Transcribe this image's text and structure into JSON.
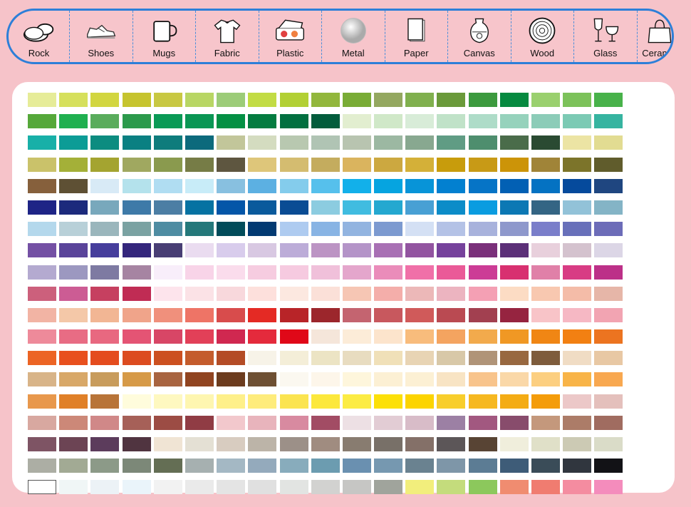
{
  "materials": [
    {
      "label": "Rock",
      "icon": "rock-icon"
    },
    {
      "label": "Shoes",
      "icon": "shoe-icon"
    },
    {
      "label": "Mugs",
      "icon": "mug-icon"
    },
    {
      "label": "Fabric",
      "icon": "tshirt-icon"
    },
    {
      "label": "Plastic",
      "icon": "plastic-container-icon"
    },
    {
      "label": "Metal",
      "icon": "metal-disc-icon"
    },
    {
      "label": "Paper",
      "icon": "paper-stack-icon"
    },
    {
      "label": "Canvas",
      "icon": "vase-icon"
    },
    {
      "label": "Wood",
      "icon": "wood-log-icon"
    },
    {
      "label": "Glass",
      "icon": "wine-glass-icon"
    },
    {
      "label": "Ceramic",
      "icon": "ceramic-bag-icon"
    }
  ],
  "colors": {
    "background": "#f6c3c9",
    "toolbar_border": "#2d7fd8",
    "panel": "#ffffff"
  },
  "swatch_rows": [
    [
      "#e6ec98",
      "#d6e05c",
      "#d2d640",
      "#c6c42e",
      "#c8c842",
      "#b8d664",
      "#9ccc78",
      "#c2dc44",
      "#b2d034",
      "#92b73c",
      "#79ac36",
      "#94a860",
      "#80b04e",
      "#6a9a3a",
      "#3c9a3e",
      "#068a40",
      "#9ad06e",
      "#7cc25a",
      "#48b24a"
    ],
    [
      "#56a83a",
      "#20b050",
      "#5aac5c",
      "#2c9a4c",
      "#0a9a56",
      "#0a9654",
      "#049044",
      "#047c40",
      "#027040",
      "#025c3c",
      "#e2eed0",
      "#d0e8c8",
      "#d8ecd8",
      "#c0e2c8",
      "#aedcc8",
      "#96d2bc",
      "#8cccb8",
      "#7ccab4",
      "#36b4a0"
    ],
    [
      "#18b0a8",
      "#0c9c96",
      "#0c8c80",
      "#0a8082",
      "#0e7c7c",
      "#0c6a7c",
      "#c2c69a",
      "#d4dcc0",
      "#b8c8b0",
      "#b0c4b4",
      "#b8c4b0",
      "#9cb8a2",
      "#88a890",
      "#609c84",
      "#4e8e6e",
      "#4a6c4a",
      "#2a4a32",
      "#ece4a4",
      "#e2dc92"
    ],
    [
      "#cac26a",
      "#a4b038",
      "#a4a430",
      "#a0a860",
      "#8a9a4e",
      "#767c46",
      "#5e5640",
      "#dec67a",
      "#d4bc70",
      "#c4ac5e",
      "#dab45e",
      "#cca840",
      "#d4b038",
      "#c89c0c",
      "#c89a16",
      "#cc9408",
      "#a08438",
      "#7c742a",
      "#605c2c"
    ],
    [
      "#86603c",
      "#5e5034",
      "#d8eaf6",
      "#b4e2ec",
      "#b0ddf2",
      "#c8ecf8",
      "#88c0e0",
      "#5cb0e2",
      "#84ccec",
      "#56c0ec",
      "#12b0ea",
      "#06a4e0",
      "#0894d8",
      "#0280d0",
      "#0674c6",
      "#0260b4",
      "#0472c2",
      "#054a9c",
      "#1f4680"
    ],
    [
      "#1e2486",
      "#1c2a7c",
      "#78a8bc",
      "#3e7aa8",
      "#4c7ea4",
      "#0672a2",
      "#0456a8",
      "#0a5a9c",
      "#0a4c94",
      "#8ccce0",
      "#40bce0",
      "#24a8d0",
      "#48a0d4",
      "#0c8cc8",
      "#0a9ce0",
      "#0c78b4",
      "#346584",
      "#92c2d8",
      "#84b4c6"
    ],
    [
      "#b4d8ec",
      "#b8d0d8",
      "#9ab6bc",
      "#7aa2a2",
      "#4e8ca2",
      "#24787a",
      "#024c5a",
      "#023a72",
      "#aecbf0",
      "#88b4e4",
      "#92b4e0",
      "#7c9ad0",
      "#d4e0f4",
      "#b4c2e6",
      "#a8b2dc",
      "#8e98cc",
      "#7a7eca",
      "#6870ba",
      "#6c6cb8"
    ],
    [
      "#7450a4",
      "#5a449a",
      "#463e9c",
      "#34267c",
      "#483e74",
      "#eadcf0",
      "#d8ccec",
      "#d8c8e2",
      "#bcacd8",
      "#bc94c4",
      "#b494c8",
      "#a870b4",
      "#9254a0",
      "#76429c",
      "#7a307a",
      "#5c3078",
      "#e8d0dc",
      "#d4c2ce",
      "#dcd6e6"
    ],
    [
      "#b4aad0",
      "#9c98c0",
      "#7e7aa2",
      "#a684a2",
      "#f8eefa",
      "#f8d4e8",
      "#fadcec",
      "#f6cce0",
      "#f6cae0",
      "#f0c0da",
      "#e4a6cc",
      "#ea8cba",
      "#f070a8",
      "#ea5a98",
      "#cc3c96",
      "#d83070",
      "#e080a8",
      "#d83c84",
      "#bc3088"
    ],
    [
      "#cc607c",
      "#cc5c94",
      "#c64060",
      "#c02c54",
      "#fde4ec",
      "#fbe2e6",
      "#f8d8dc",
      "#fde0dc",
      "#fce8e0",
      "#fbe0d8",
      "#f6c6b4",
      "#f4aeaa",
      "#ecb8b8",
      "#ecb4c0",
      "#f4a0b4",
      "#fcdcc4",
      "#f8c8b0",
      "#f4bca8",
      "#e6b6a8"
    ],
    [
      "#f2b4a4",
      "#f4c8a8",
      "#f2b694",
      "#f0a48a",
      "#f0907c",
      "#ee7466",
      "#d84c4c",
      "#e42a24",
      "#b82428",
      "#9c262c",
      "#c46470",
      "#c8585e",
      "#d05a5a",
      "#ba4a52",
      "#a24050",
      "#962440",
      "#f8c4c8",
      "#f6b8c4",
      "#f2a4b2"
    ],
    [
      "#ee8a9a",
      "#e86c84",
      "#e86880",
      "#e45474",
      "#d84666",
      "#e24058",
      "#d02850",
      "#e42a3c",
      "#e00818",
      "#f5e6da",
      "#fcecd8",
      "#fce4cc",
      "#f8bc7c",
      "#f4a460",
      "#f2aa4c",
      "#f09824",
      "#f08614",
      "#f28012",
      "#ec7420"
    ],
    [
      "#ec6424",
      "#e8501e",
      "#e44c1e",
      "#dc4c20",
      "#cc5020",
      "#c45c2c",
      "#b44c26",
      "#f7f3e8",
      "#f4eed8",
      "#ece4c4",
      "#e8dcc0",
      "#f0e0b8",
      "#e8d4b4",
      "#d8c8a8",
      "#b09478",
      "#986840",
      "#7e5c3c",
      "#f0dcc4",
      "#e8c8a4"
    ],
    [
      "#d8b488",
      "#d8a868",
      "#c89c5c",
      "#d69a48",
      "#a86440",
      "#904420",
      "#6c3c1e",
      "#6e5034",
      "#fbf8f0",
      "#fdf6ea",
      "#fef6dc",
      "#fcf0d4",
      "#fcf0d4",
      "#f8e4c4",
      "#f8c48c",
      "#fad8a8",
      "#fccf80",
      "#f8b448",
      "#f8a850"
    ],
    [
      "#e8984c",
      "#e08028",
      "#b87438",
      "#fffcdc",
      "#fef8c0",
      "#fef6b0",
      "#fef08a",
      "#feec7c",
      "#fbe450",
      "#fce83c",
      "#fcec44",
      "#fce008",
      "#fcd400",
      "#f8ce2c",
      "#f6b820",
      "#f4ac14",
      "#f49c0a",
      "#ecc8c8",
      "#e4c0bc"
    ],
    [
      "#d8a8a0",
      "#cc8878",
      "#d08888",
      "#a66058",
      "#9c4c44",
      "#903c44",
      "#f2c8cc",
      "#e8b4bc",
      "#d88aa0",
      "#a24c64",
      "#ede0e4",
      "#e2ccd4",
      "#d8bcc8",
      "#9c80a4",
      "#a25880",
      "#884c6c",
      "#c4987c",
      "#ac7c68",
      "#a06c60"
    ],
    [
      "#7e5464",
      "#6c4454",
      "#5c3c5c",
      "#503440",
      "#f0e4d4",
      "#e4e0d4",
      "#d8ccc0",
      "#bcb4a8",
      "#9c9088",
      "#a08c80",
      "#887c70",
      "#787068",
      "#847068",
      "#5c5658",
      "#584434",
      "#f0eedc",
      "#e0e0c8",
      "#cccab4",
      "#dadcc8"
    ],
    [
      "#acaea4",
      "#a2aa94",
      "#8c9a88",
      "#7c8878",
      "#646e54",
      "#a6b0b0",
      "#a4b8c4",
      "#94aabc",
      "#88acbc",
      "#6c9cb0",
      "#6a90b0",
      "#7698b0",
      "#6a8290",
      "#7e96a8",
      "#5c7c94",
      "#3e5c78",
      "#3a4c58",
      "#30363e",
      "#121216"
    ],
    [
      "#ffffff",
      "#f0f6f6",
      "#ecf2f6",
      "#eaf4fa",
      "#f2f2f2",
      "#eaeaea",
      "#e4e4e4",
      "#e0e0e0",
      "#e2e4e2",
      "#d2d2d0",
      "#c6c6c4",
      "#a0a49c",
      "#f2ee7c",
      "#c4dc7c",
      "#8cc85c",
      "#f08c70",
      "#f07c70",
      "#f48ca0",
      "#f48cbc"
    ]
  ]
}
